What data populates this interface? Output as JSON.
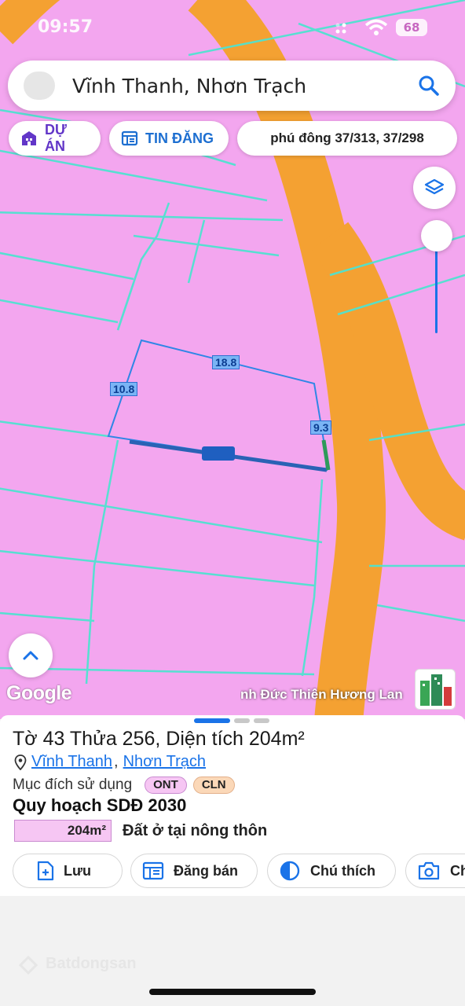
{
  "status_bar": {
    "time": "09:57",
    "battery": "68"
  },
  "search": {
    "query": "Vĩnh Thanh, Nhơn Trạch"
  },
  "chips": {
    "project": "DỰ ÁN",
    "listing": "TIN ĐĂNG",
    "filter": "phú đông 37/313, 37/298"
  },
  "map": {
    "edge_labels": {
      "top": "18.8",
      "left": "10.8",
      "right": "9.3"
    },
    "attribution": "nh Đức Thiên Hương Lan",
    "google_logo": "Google"
  },
  "parcel": {
    "title": "Tờ 43 Thửa 256, Diện tích 204m²",
    "commune": "Vĩnh Thanh",
    "district": "Nhơn Trạch",
    "purpose_label": "Mục đích sử dụng",
    "purpose_codes": [
      "ONT",
      "CLN"
    ],
    "plan_title": "Quy hoạch SDĐ 2030",
    "plan_area": "204m²",
    "plan_type": "Đất ở tại nông thôn"
  },
  "actions": {
    "save": "Lưu",
    "post": "Đăng bán",
    "legend": "Chú thích",
    "more": "Ch"
  },
  "watermark": "Batdongsan",
  "colors": {
    "land_pink": "#f3a6ef",
    "road_orange": "#f4a132",
    "parcel_line": "#4fe3d0",
    "accent_blue": "#1a73e8"
  }
}
